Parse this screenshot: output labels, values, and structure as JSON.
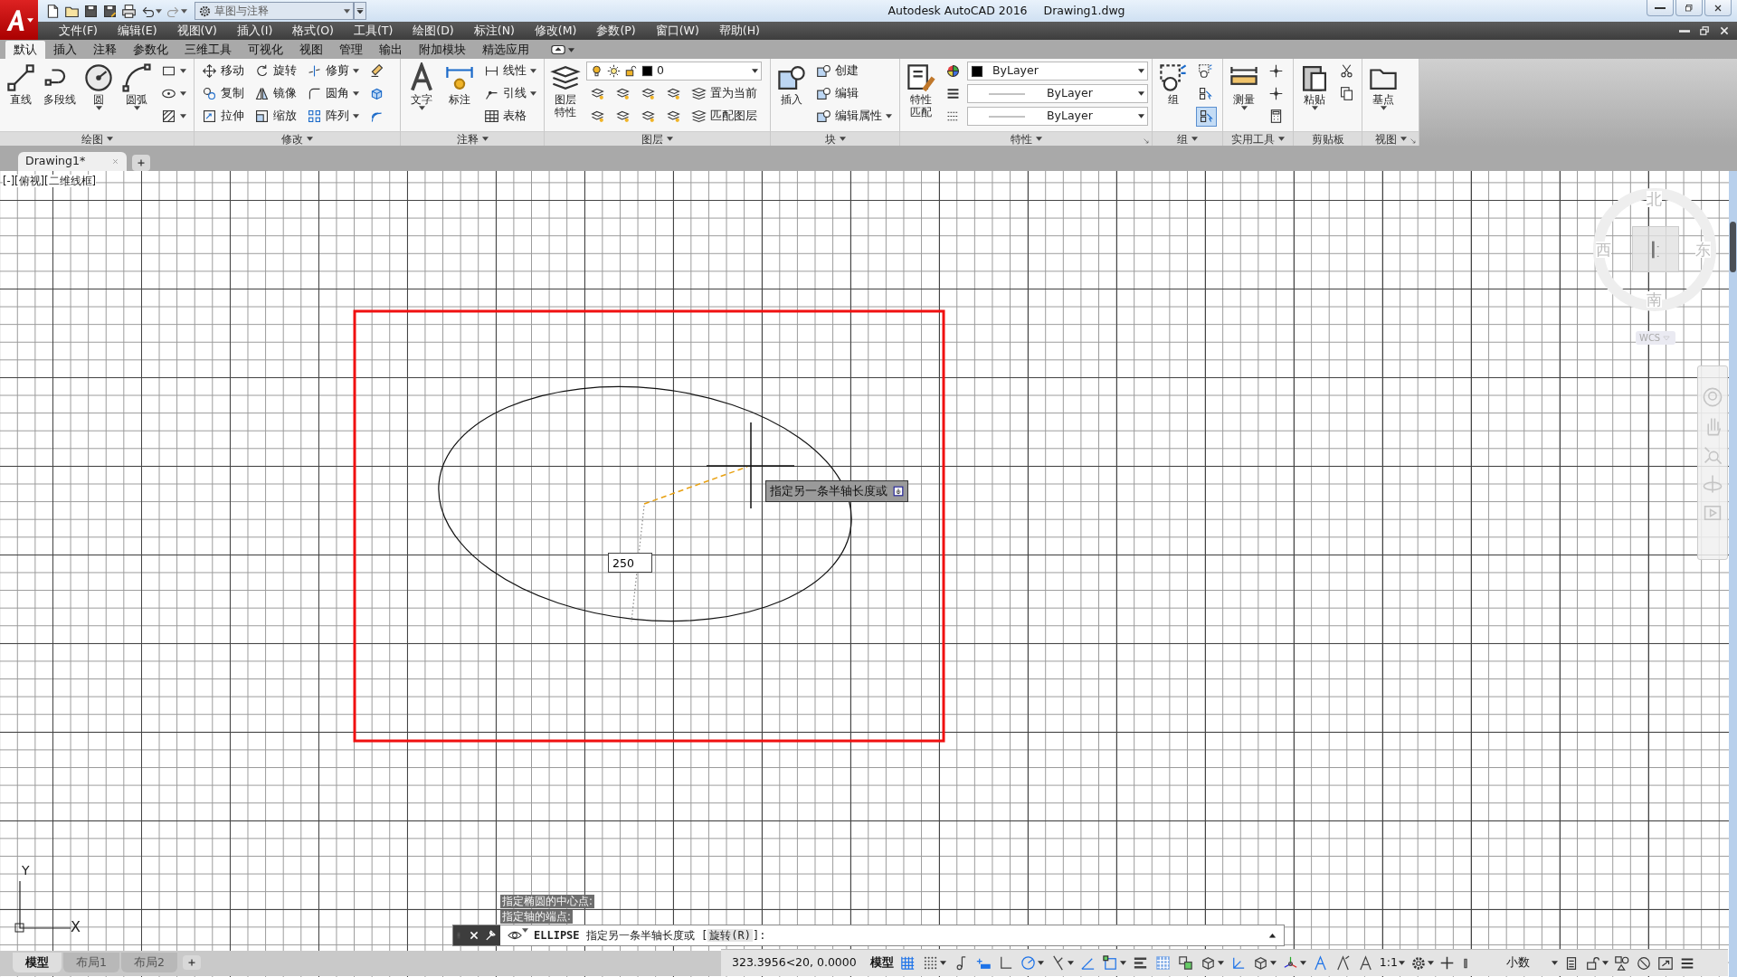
{
  "title_bar": {
    "workspace": "草图与注释",
    "app_title": "Autodesk AutoCAD 2016",
    "document": "Drawing1.dwg"
  },
  "menu_bar": [
    "文件(F)",
    "编辑(E)",
    "视图(V)",
    "插入(I)",
    "格式(O)",
    "工具(T)",
    "绘图(D)",
    "标注(N)",
    "修改(M)",
    "参数(P)",
    "窗口(W)",
    "帮助(H)"
  ],
  "ribbon_tabs": [
    {
      "label": "默认",
      "selected": true
    },
    {
      "label": "插入",
      "selected": false
    },
    {
      "label": "注释",
      "selected": false
    },
    {
      "label": "参数化",
      "selected": false
    },
    {
      "label": "三维工具",
      "selected": false
    },
    {
      "label": "可视化",
      "selected": false
    },
    {
      "label": "视图",
      "selected": false
    },
    {
      "label": "管理",
      "selected": false
    },
    {
      "label": "输出",
      "selected": false
    },
    {
      "label": "附加模块",
      "selected": false
    },
    {
      "label": "精选应用",
      "selected": false
    }
  ],
  "ribbon_panels": [
    {
      "title": "绘图",
      "menu": true,
      "launcher": false,
      "large": [
        {
          "label": "直线",
          "menu": false
        },
        {
          "label": "多段线",
          "menu": false
        },
        {
          "label": "圆",
          "menu": true
        },
        {
          "label": "圆弧",
          "menu": true
        }
      ],
      "rows": [
        [
          {
            "kind": "icon",
            "menu": true
          }
        ],
        [
          {
            "kind": "icon",
            "menu": true
          }
        ],
        [
          {
            "kind": "icon",
            "menu": true
          }
        ]
      ]
    },
    {
      "title": "修改",
      "menu": true,
      "launcher": false,
      "rows": [
        [
          {
            "kind": "small",
            "label": "移动",
            "menu": false
          },
          {
            "kind": "small",
            "label": "旋转",
            "menu": false
          },
          {
            "kind": "small",
            "label": "修剪",
            "menu": true
          },
          {
            "kind": "icon",
            "menu": false
          }
        ],
        [
          {
            "kind": "small",
            "label": "复制",
            "menu": false
          },
          {
            "kind": "small",
            "label": "镜像",
            "menu": false
          },
          {
            "kind": "small",
            "label": "圆角",
            "menu": true
          },
          {
            "kind": "icon",
            "menu": false
          }
        ],
        [
          {
            "kind": "small",
            "label": "拉伸",
            "menu": false
          },
          {
            "kind": "small",
            "label": "缩放",
            "menu": false
          },
          {
            "kind": "small",
            "label": "阵列",
            "menu": true
          },
          {
            "kind": "icon",
            "menu": false
          }
        ]
      ]
    },
    {
      "title": "注释",
      "menu": true,
      "launcher": false,
      "large": [
        {
          "label": "文字",
          "menu": true
        },
        {
          "label": "标注",
          "menu": false
        }
      ],
      "rows": [
        [
          {
            "kind": "small",
            "label": "线性",
            "menu": true
          }
        ],
        [
          {
            "kind": "small",
            "label": "引线",
            "menu": true
          }
        ],
        [
          {
            "kind": "small",
            "label": "表格",
            "menu": false
          }
        ]
      ]
    },
    {
      "title": "图层",
      "menu": true,
      "launcher": false,
      "large": [
        {
          "label": "图层特性",
          "menu": false
        }
      ],
      "rows": [
        [
          {
            "kind": "layer-combo",
            "value": "0"
          }
        ],
        [
          {
            "kind": "icon",
            "menu": false
          },
          {
            "kind": "icon",
            "menu": false
          },
          {
            "kind": "icon",
            "menu": false
          },
          {
            "kind": "icon",
            "menu": false
          },
          {
            "kind": "small",
            "label": "置为当前",
            "menu": false
          }
        ],
        [
          {
            "kind": "icon",
            "menu": false
          },
          {
            "kind": "icon",
            "menu": false
          },
          {
            "kind": "icon",
            "menu": false
          },
          {
            "kind": "icon",
            "menu": false
          },
          {
            "kind": "small",
            "label": "匹配图层",
            "menu": false
          }
        ]
      ]
    },
    {
      "title": "块",
      "menu": true,
      "launcher": false,
      "large": [
        {
          "label": "插入",
          "menu": false
        }
      ],
      "rows": [
        [
          {
            "kind": "small",
            "label": "创建",
            "menu": false
          }
        ],
        [
          {
            "kind": "small",
            "label": "编辑",
            "menu": false
          }
        ],
        [
          {
            "kind": "small",
            "label": "编辑属性",
            "menu": true
          }
        ]
      ]
    },
    {
      "title": "特性",
      "menu": true,
      "launcher": true,
      "large": [
        {
          "label": "特性匹配",
          "menu": false
        }
      ],
      "rows": [
        [
          {
            "kind": "icon",
            "menu": false
          },
          {
            "kind": "color-combo",
            "value": "ByLayer"
          }
        ],
        [
          {
            "kind": "icon",
            "menu": false
          },
          {
            "kind": "line-combo",
            "value": "ByLayer"
          }
        ],
        [
          {
            "kind": "icon",
            "menu": false
          },
          {
            "kind": "line-combo",
            "value": "ByLayer"
          }
        ]
      ]
    },
    {
      "title": "组",
      "menu": true,
      "launcher": false,
      "large": [
        {
          "label": "组",
          "menu": false
        }
      ],
      "rows": [
        [
          {
            "kind": "icon",
            "menu": false,
            "on": false
          }
        ],
        [
          {
            "kind": "icon",
            "menu": false,
            "on": false
          }
        ],
        [
          {
            "kind": "icon",
            "menu": false,
            "on": true
          }
        ]
      ]
    },
    {
      "title": "实用工具",
      "menu": true,
      "launcher": false,
      "large": [
        {
          "label": "测量",
          "menu": true
        }
      ],
      "rows": [
        [
          {
            "kind": "icon",
            "menu": false
          }
        ],
        [
          {
            "kind": "icon",
            "menu": false
          }
        ],
        [
          {
            "kind": "icon",
            "menu": false
          }
        ]
      ]
    },
    {
      "title": "剪贴板",
      "menu": false,
      "launcher": false,
      "large": [
        {
          "label": "粘贴",
          "menu": true
        }
      ],
      "rows": [
        [
          {
            "kind": "icon",
            "menu": false
          }
        ],
        [
          {
            "kind": "icon",
            "menu": false
          }
        ]
      ]
    },
    {
      "title": "视图",
      "menu": true,
      "launcher": true,
      "large": [
        {
          "label": "基点",
          "menu": true
        }
      ]
    }
  ],
  "document_tabs": [
    {
      "label": "Drawing1*",
      "selected": true
    }
  ],
  "viewport_label": "[-][俯视][二维线框]",
  "canvas": {
    "tooltip": "指定另一条半轴长度或",
    "dynamic_input": "250",
    "ucs": {
      "y_label": "Y",
      "x_label": "X"
    }
  },
  "viewcube": {
    "north": "北",
    "west": "西",
    "east": "东",
    "south": "南",
    "coordinate_system": "WCS"
  },
  "command_history": [
    "指定椭圆的中心点:",
    "指定轴的端点:"
  ],
  "command_line": {
    "prompt": "**ELLIPSE** 指定另一条半轴长度或 [",
    "option": "旋转(R)",
    "suffix": "]:"
  },
  "layout_tabs": [
    {
      "label": "模型",
      "selected": true
    },
    {
      "label": "布局1",
      "selected": false
    },
    {
      "label": "布局2",
      "selected": false
    }
  ],
  "status_bar": {
    "coordinates": "323.3956<20, 0.0000",
    "space": "模型",
    "toggles": [
      {
        "on": true,
        "menu": false
      },
      {
        "on": false,
        "menu": true
      },
      {
        "on": false,
        "menu": false
      },
      {
        "on": true,
        "menu": false
      },
      {
        "on": false,
        "menu": false
      },
      {
        "on": true,
        "menu": true
      },
      {
        "on": false,
        "menu": true
      },
      {
        "on": true,
        "menu": false
      },
      {
        "on": true,
        "menu": true
      },
      {
        "on": false,
        "menu": false
      },
      {
        "on": true,
        "menu": false
      },
      {
        "on": false,
        "menu": false
      },
      {
        "on": false,
        "menu": true
      },
      {
        "on": true,
        "menu": false
      },
      {
        "on": false,
        "menu": true
      },
      {
        "on": false,
        "menu": true
      },
      {
        "on": true,
        "menu": false
      },
      {
        "on": false,
        "menu": false
      },
      {
        "on": false,
        "menu": false
      }
    ],
    "annotation_scale": "1:1",
    "units": "小数"
  }
}
